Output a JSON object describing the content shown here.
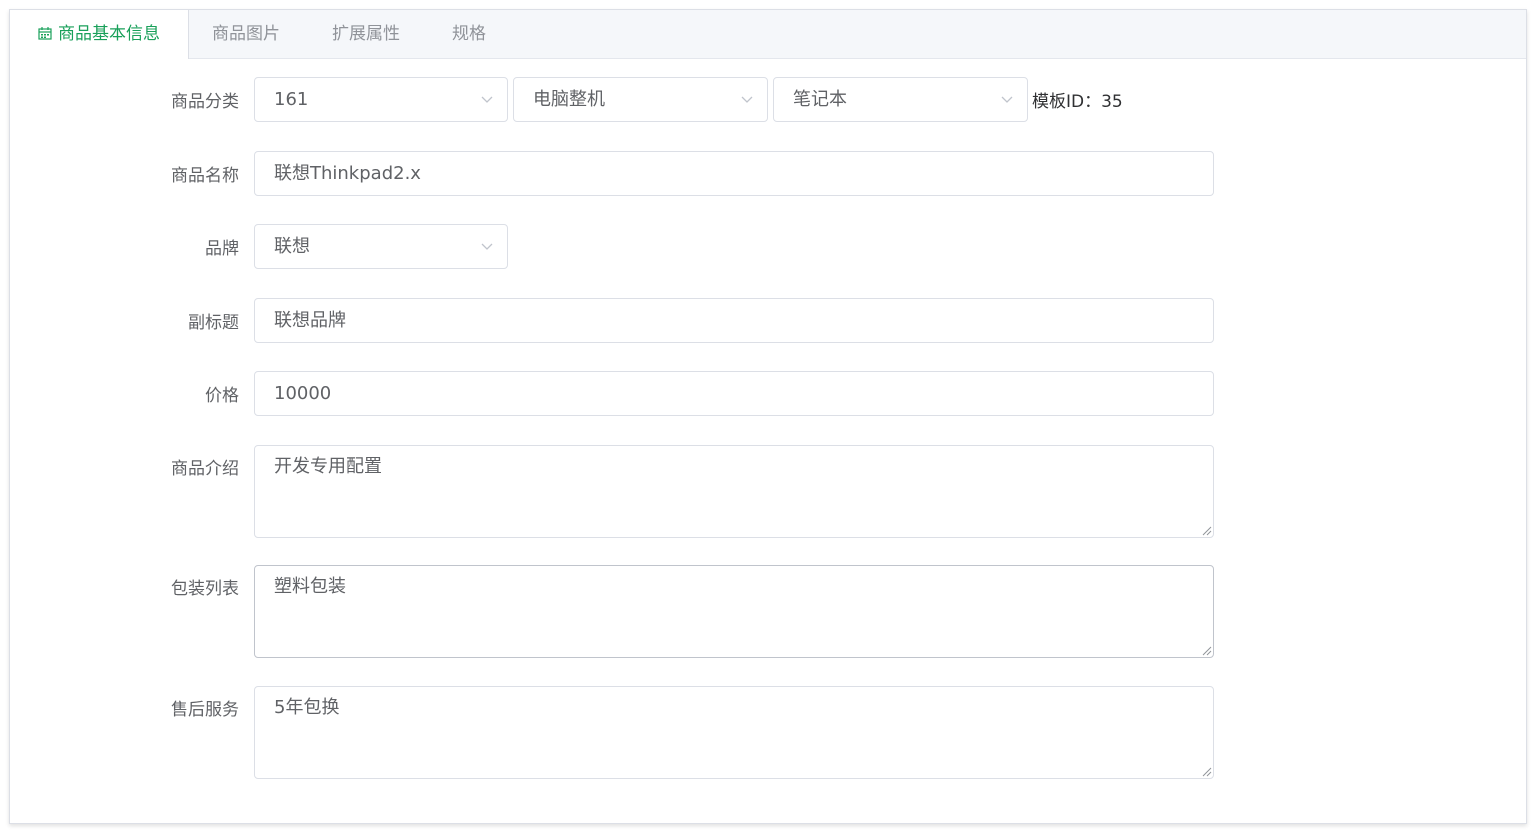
{
  "tabs": [
    {
      "label": "商品基本信息",
      "active": true
    },
    {
      "label": "商品图片"
    },
    {
      "label": "扩展属性"
    },
    {
      "label": "规格"
    }
  ],
  "form": {
    "category": {
      "label": "商品分类",
      "level1": "161",
      "level2": "电脑整机",
      "level3": "笔记本",
      "template_label": "模板ID：",
      "template_id": "35"
    },
    "name": {
      "label": "商品名称",
      "value": "联想Thinkpad2.x"
    },
    "brand": {
      "label": "品牌",
      "value": "联想"
    },
    "subtitle": {
      "label": "副标题",
      "value": "联想品牌"
    },
    "price": {
      "label": "价格",
      "value": "10000"
    },
    "intro": {
      "label": "商品介绍",
      "value": "开发专用配置"
    },
    "package": {
      "label": "包装列表",
      "value": "塑料包装"
    },
    "service": {
      "label": "售后服务",
      "value": "5年包换"
    }
  },
  "colors": {
    "accent": "#19a05a",
    "border": "#dcdfe6",
    "tab_bg": "#f5f7fa"
  },
  "icons": {
    "tab_icon": "calendar-icon",
    "select_arrow": "chevron-down-icon",
    "resize": "resize-handle-icon"
  }
}
